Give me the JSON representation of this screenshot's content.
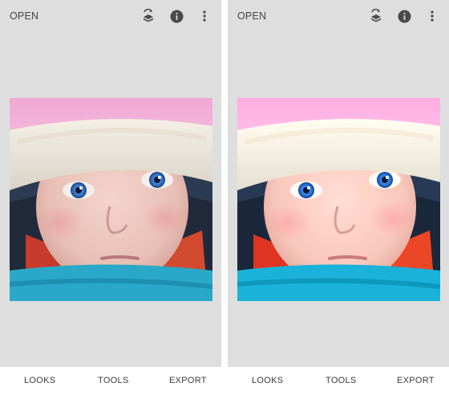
{
  "screens": [
    {
      "id": "before",
      "open_label": "OPEN",
      "icons": [
        "undo-layers-icon",
        "info-icon",
        "more-vert-icon"
      ],
      "nav": {
        "looks": "LOOKS",
        "tools": "TOOLS",
        "export": "EXPORT"
      },
      "photo_subject": "baby in knit hat"
    },
    {
      "id": "after",
      "open_label": "OPEN",
      "icons": [
        "undo-layers-icon",
        "info-icon",
        "more-vert-icon"
      ],
      "nav": {
        "looks": "LOOKS",
        "tools": "TOOLS",
        "export": "EXPORT"
      },
      "photo_subject": "baby in knit hat"
    }
  ],
  "colors": {
    "app_background": "#dedede",
    "bar_background": "#ffffff",
    "text": "#444444",
    "icon": "#4a4a4a"
  }
}
